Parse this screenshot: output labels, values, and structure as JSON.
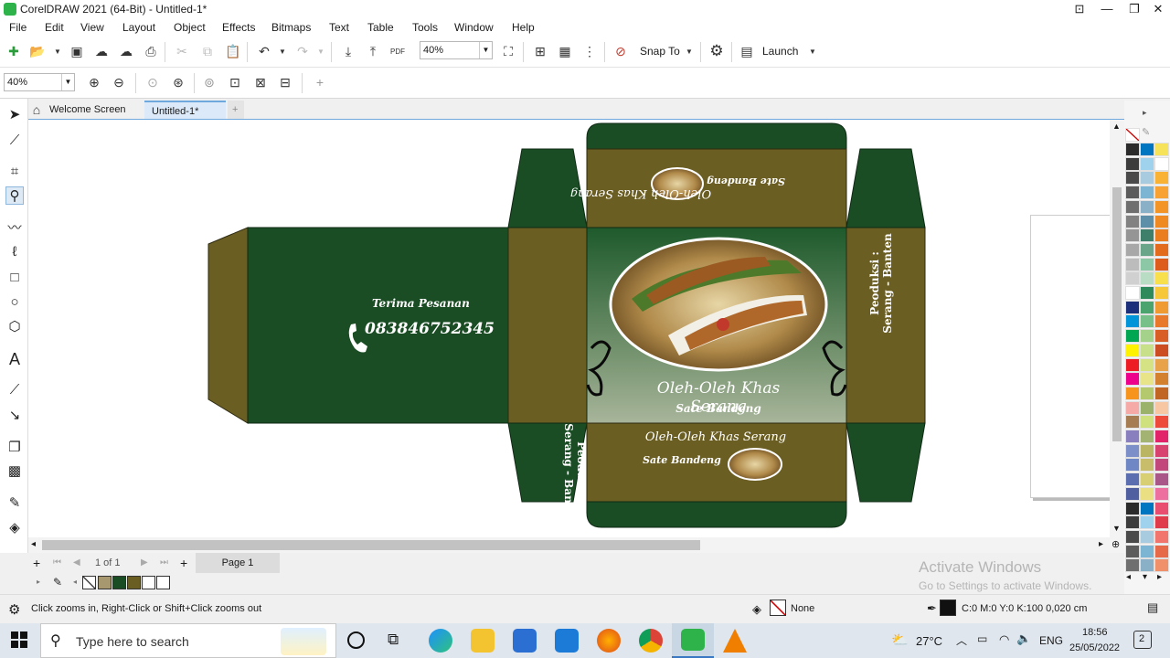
{
  "window": {
    "title": "CorelDRAW 2021 (64-Bit) - Untitled-1*"
  },
  "menu": [
    "File",
    "Edit",
    "View",
    "Layout",
    "Object",
    "Effects",
    "Bitmaps",
    "Text",
    "Table",
    "Tools",
    "Window",
    "Help"
  ],
  "toolbar": {
    "zoom_value": "40%",
    "snap_label": "Snap To",
    "launch_label": "Launch"
  },
  "toolbar2": {
    "zoom_value": "40%"
  },
  "tabs": {
    "welcome": "Welcome Screen",
    "doc": "Untitled-1*",
    "add": "+"
  },
  "design": {
    "order_label": "Terima Pesanan",
    "phone": "083846752345",
    "production_line1": "Peoduksi :",
    "production_line2": "Serang - Banten",
    "brand": "Oleh-Oleh Khas Serang",
    "product": "Sate Bandeng",
    "colors": {
      "green": "#1a4d24",
      "olive": "#6b5e22"
    }
  },
  "pagebar": {
    "page_counter": "1 of 1",
    "page_tab": "Page 1"
  },
  "status": {
    "hint": "Click zooms in, Right-Click or Shift+Click zooms out",
    "fill": "None",
    "outline": "C:0 M:0 Y:0 K:100  0,020 cm"
  },
  "watermark": {
    "line1": "Activate Windows",
    "line2": "Go to Settings to activate Windows."
  },
  "taskbar": {
    "search_placeholder": "Type here to search",
    "temperature": "27°C",
    "language": "ENG",
    "time": "18:56",
    "date": "25/05/2022",
    "notifications": "2"
  },
  "palette_colors": [
    "#2b2b2b",
    "#0076c0",
    "#3c3c3c",
    "#9fd2ec",
    "#4a4a4a",
    "#a8cbe0",
    "#5c5c5c",
    "#7bb5d3",
    "#6f6f6f",
    "#8ab0c8",
    "#828282",
    "#5d8fa8",
    "#959595",
    "#3e7f6b",
    "#a8a8a8",
    "#6aa58a",
    "#bcbcbc",
    "#8cc8a6",
    "#d0d0d0",
    "#b8dcc4",
    "#ffffff",
    "#2e8a5a",
    "#1b2f7a",
    "#4ba36e",
    "#0094d9",
    "#78c08a",
    "#00a651",
    "#a5d28a",
    "#fff200",
    "#c9e08a",
    "#ed1c24",
    "#d6e384",
    "#ec008c",
    "#e8e489",
    "#f7941d",
    "#b4c86e",
    "#f6aaa8",
    "#9bb26a",
    "#a67c52",
    "#cfe07e",
    "#8a7fbe",
    "#a3b472",
    "#7c8fc8",
    "#b9b562",
    "#6f87c4",
    "#c8bd6a",
    "#5b6fb0",
    "#d8cf74",
    "#4f5fa0",
    "#eadf82"
  ],
  "palette_right_col": [
    "#f6e35a",
    "#ffffff",
    "#f9b233",
    "#f7a233",
    "#f39526",
    "#ef8a22",
    "#ea7d1e",
    "#e36b1d",
    "#dd5c1c",
    "#f7e04b",
    "#f7c73a",
    "#f09a32",
    "#e8792b",
    "#d95e25",
    "#cc4d22",
    "#e8a34a",
    "#d4812f",
    "#c16525",
    "#f6c7a2",
    "#ed4a3c",
    "#e2236a",
    "#d8426f",
    "#c2487b",
    "#a95688",
    "#ec6fa0",
    "#e94d6f",
    "#e03b4b",
    "#f1756c",
    "#e66a4a",
    "#f0906b",
    "#cf7a50",
    "#b4584a",
    "#f4b9b1",
    "#de5b76",
    "#c43d62",
    "#9e3050",
    "#f6d27b",
    "#f9e15d"
  ]
}
